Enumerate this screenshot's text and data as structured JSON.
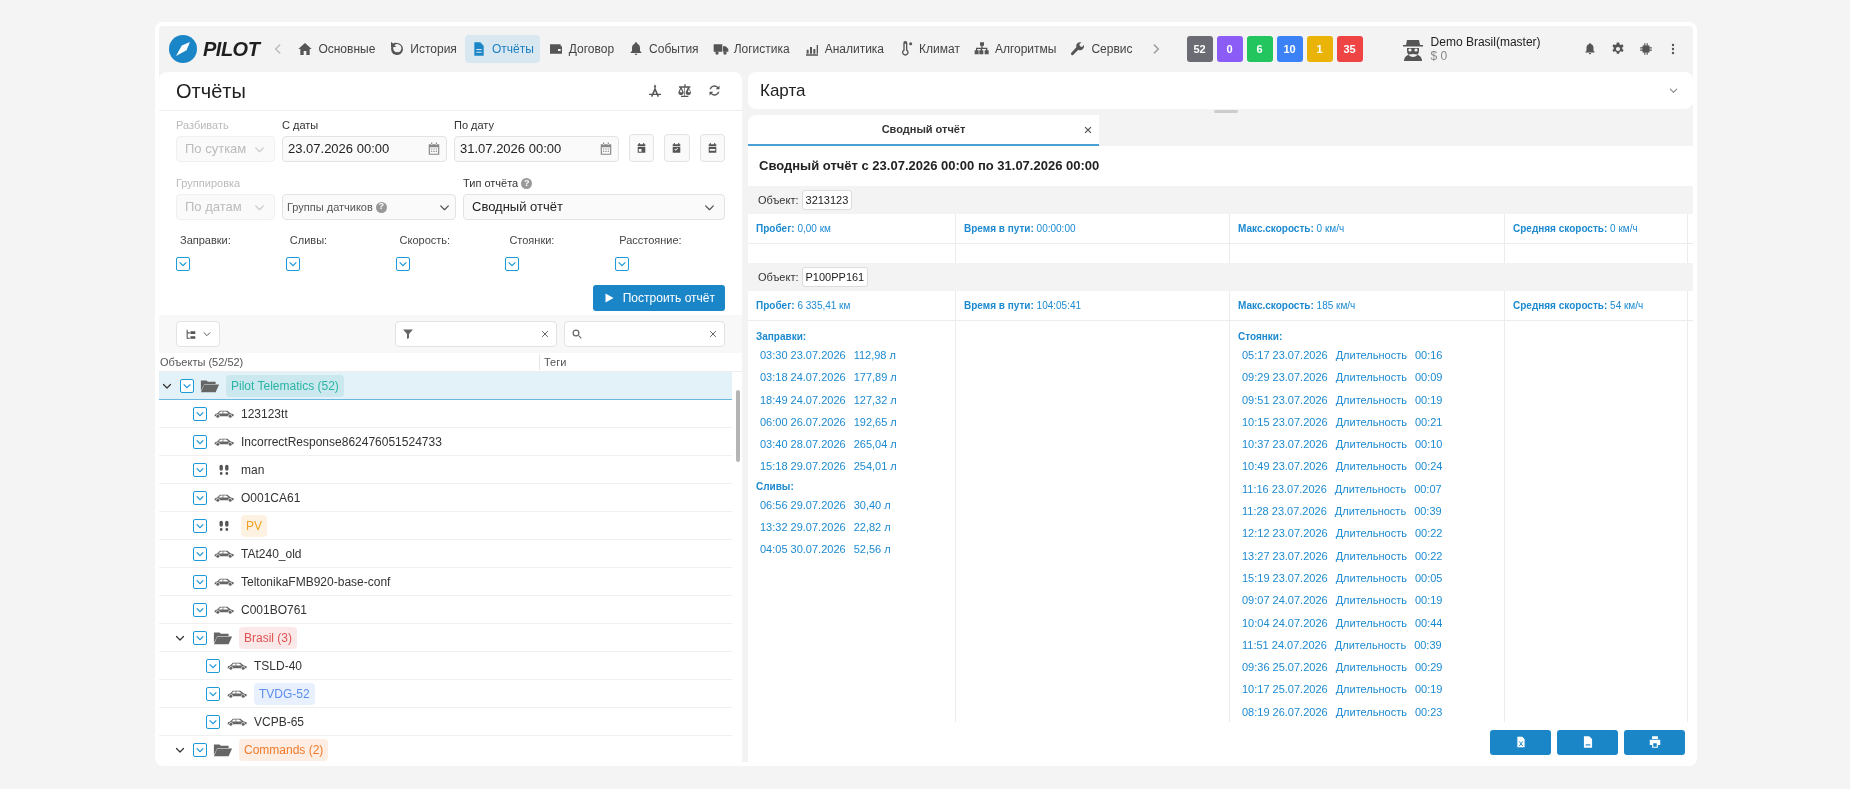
{
  "brand": {
    "name": "PILOT"
  },
  "nav": [
    {
      "label": "Основные",
      "selected": false
    },
    {
      "label": "История",
      "selected": false
    },
    {
      "label": "Отчёты",
      "selected": true
    },
    {
      "label": "Договор",
      "selected": false
    },
    {
      "label": "События",
      "selected": false
    },
    {
      "label": "Логистика",
      "selected": false
    },
    {
      "label": "Аналитика",
      "selected": false
    },
    {
      "label": "Климат",
      "selected": false
    },
    {
      "label": "Алгоритмы",
      "selected": false
    },
    {
      "label": "Сервис",
      "selected": false
    }
  ],
  "counters": [
    {
      "value": "52",
      "color": "#6b6b73"
    },
    {
      "value": "0",
      "color": "#8b5cf6"
    },
    {
      "value": "6",
      "color": "#22c55e"
    },
    {
      "value": "10",
      "color": "#3b82f6"
    },
    {
      "value": "1",
      "color": "#eab308"
    },
    {
      "value": "35",
      "color": "#ef4444"
    }
  ],
  "user": {
    "name": "Demo Brasil(master)",
    "balance": "$ 0"
  },
  "reports_panel": {
    "title": "Отчёты",
    "split": {
      "label": "Разбивать",
      "value": "По суткам",
      "disabled": true
    },
    "date_from": {
      "label": "С даты",
      "value": "23.07.2026 00:00"
    },
    "date_to": {
      "label": "По дату",
      "value": "31.07.2026 00:00"
    },
    "grouping": {
      "label": "Группировка",
      "value": "По датам",
      "disabled": true
    },
    "sensor_groups": {
      "placeholder": "Группы датчиков",
      "help": "?",
      "disabled": false
    },
    "report_type": {
      "label": "Тип отчёта",
      "help": "?",
      "value": "Сводный отчёт",
      "disabled": false
    },
    "filters": [
      {
        "label": "Заправки:",
        "checked": true
      },
      {
        "label": "Сливы:",
        "checked": true
      },
      {
        "label": "Скорость:",
        "checked": true
      },
      {
        "label": "Стоянки:",
        "checked": true
      },
      {
        "label": "Расстояние:",
        "checked": true
      }
    ],
    "build_button": "Построить отчёт",
    "columns": [
      "Объекты (52/52)",
      "Теги"
    ]
  },
  "tree": [
    {
      "label": "Pilot Telematics (52)",
      "kind": "folder",
      "checked": true,
      "expanded": true,
      "selected": true,
      "color": "#2bb5a6",
      "children": [
        {
          "label": "123123tt",
          "kind": "car",
          "checked": true,
          "selected": false
        },
        {
          "label": "IncorrectResponse862476051524733",
          "kind": "car",
          "checked": true,
          "selected": false
        },
        {
          "label": "man",
          "kind": "person",
          "checked": true,
          "selected": false
        },
        {
          "label": "O001CA61",
          "kind": "car",
          "checked": true,
          "selected": false
        },
        {
          "label": "PV",
          "kind": "person",
          "checked": true,
          "selected": false,
          "color": "#f0a020"
        },
        {
          "label": "TAt240_old",
          "kind": "car",
          "checked": true,
          "selected": false
        },
        {
          "label": "TeltonikaFMB920-base-conf",
          "kind": "car",
          "checked": true,
          "selected": false
        },
        {
          "label": "C001BO761",
          "kind": "car",
          "checked": true,
          "selected": false
        },
        {
          "label": "Brasil (3)",
          "kind": "folder",
          "checked": true,
          "expanded": true,
          "selected": false,
          "color": "#e05252",
          "children": [
            {
              "label": "TSLD-40",
              "kind": "car",
              "checked": true,
              "selected": false
            },
            {
              "label": "TVDG-52",
              "kind": "car",
              "checked": true,
              "selected": false,
              "color": "#5b8def"
            },
            {
              "label": "VCPB-65",
              "kind": "car",
              "checked": true,
              "selected": false
            }
          ]
        },
        {
          "label": "Commands (2)",
          "kind": "folder",
          "checked": true,
          "expanded": true,
          "selected": false,
          "color": "#f07a2a"
        }
      ]
    }
  ],
  "map_panel": {
    "title": "Карта",
    "expanded": false
  },
  "report_tabs": [
    {
      "label": "Сводный отчёт",
      "selected": true
    }
  ],
  "report": {
    "title": "Сводный отчёт с 23.07.2026 00:00 по 31.07.2026 00:00",
    "objects": [
      {
        "label": "Объект:",
        "name": "3213123",
        "stats": [
          "**Пробег:** 0,00 км",
          "**Время в пути:** 00:00:00",
          "**Макс.скорость:** 0 км/ч",
          "**Средняя скорость:** 0 км/ч"
        ]
      },
      {
        "label": "Объект:",
        "name": "Р100РР161",
        "stats": [
          "**Пробег:** 6 335,41 км",
          "**Время в пути:** 104:05:41",
          "**Макс.скорость:** 185 км/ч",
          "**Средняя скорость:** 54 км/ч"
        ],
        "sections": [
          {
            "kind": "refuels",
            "title": "Заправки:",
            "rows": [
              [
                "03:30 23.07.2026",
                "112,98 л"
              ],
              [
                "03:18 24.07.2026",
                "177,89 л"
              ],
              [
                "18:49 24.07.2026",
                "127,32 л"
              ],
              [
                "06:00 26.07.2026",
                "192,65 л"
              ],
              [
                "03:40 28.07.2026",
                "265,04 л"
              ],
              [
                "15:18 29.07.2026",
                "254,01 л"
              ]
            ]
          },
          {
            "kind": "drains",
            "title": "Сливы:",
            "rows": [
              [
                "06:56 29.07.2026",
                "30,40 л"
              ],
              [
                "13:32 29.07.2026",
                "22,82 л"
              ],
              [
                "04:05 30.07.2026",
                "52,56 л"
              ]
            ]
          },
          {
            "kind": "stops",
            "title": "Стоянки:",
            "rows": [
              [
                "05:17 23.07.2026",
                "Длительность",
                "00:16"
              ],
              [
                "09:29 23.07.2026",
                "Длительность",
                "00:09"
              ],
              [
                "09:51 23.07.2026",
                "Длительность",
                "00:19"
              ],
              [
                "10:15 23.07.2026",
                "Длительность",
                "00:21"
              ],
              [
                "10:37 23.07.2026",
                "Длительность",
                "00:10"
              ],
              [
                "10:49 23.07.2026",
                "Длительность",
                "00:24"
              ],
              [
                "11:16 23.07.2026",
                "Длительность",
                "00:07"
              ],
              [
                "11:28 23.07.2026",
                "Длительность",
                "00:39"
              ],
              [
                "12:12 23.07.2026",
                "Длительность",
                "00:22"
              ],
              [
                "13:27 23.07.2026",
                "Длительность",
                "00:22"
              ],
              [
                "15:19 23.07.2026",
                "Длительность",
                "00:05"
              ],
              [
                "09:07 24.07.2026",
                "Длительность",
                "00:19"
              ],
              [
                "10:04 24.07.2026",
                "Длительность",
                "00:44"
              ],
              [
                "11:51 24.07.2026",
                "Длительность",
                "00:39"
              ],
              [
                "09:36 25.07.2026",
                "Длительность",
                "00:29"
              ],
              [
                "10:17 25.07.2026",
                "Длительность",
                "00:19"
              ],
              [
                "08:19 26.07.2026",
                "Длительность",
                "00:23"
              ]
            ]
          }
        ]
      }
    ]
  }
}
